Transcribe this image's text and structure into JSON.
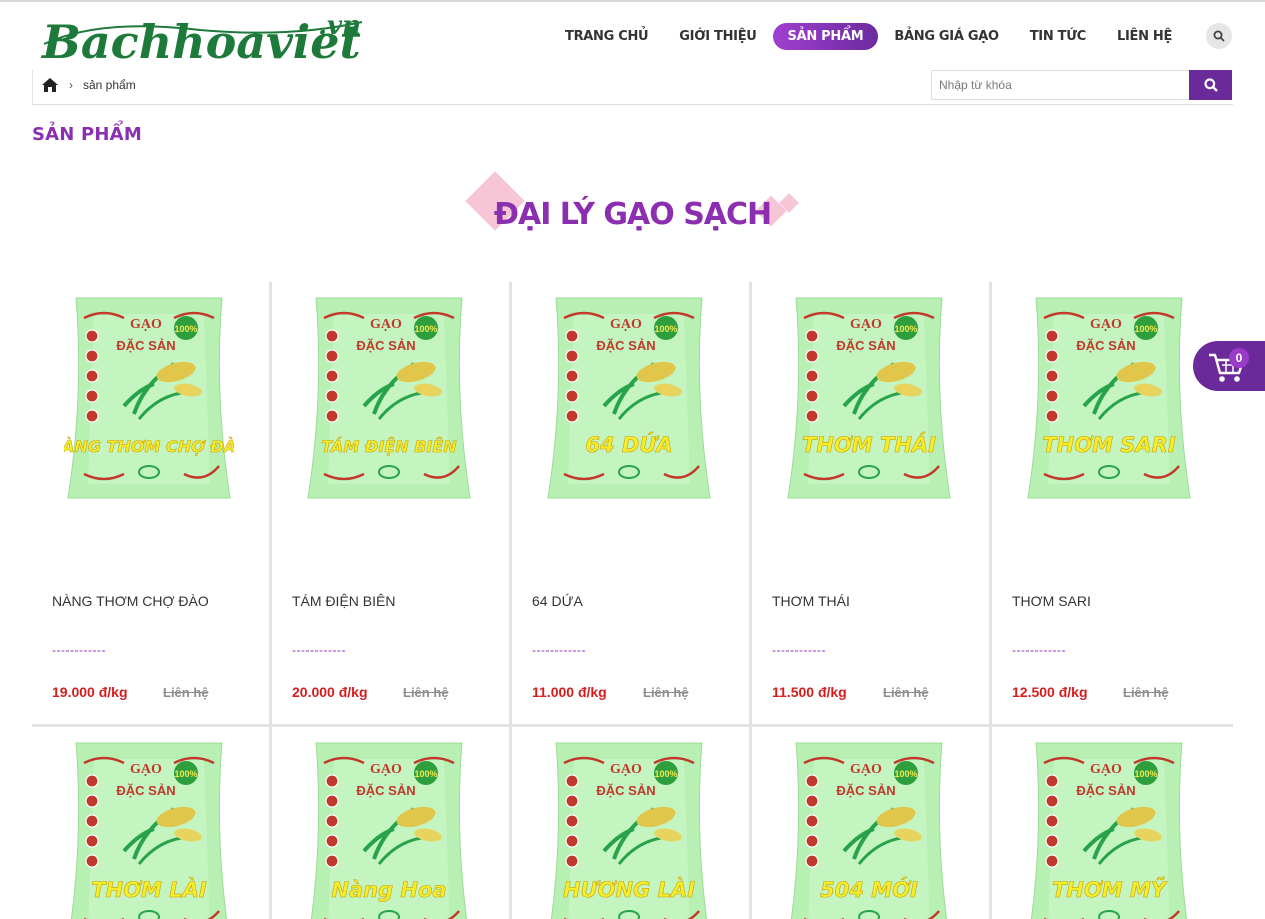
{
  "site": {
    "logo_text": "Bachhoaviet",
    "logo_suffix": ".vn"
  },
  "nav": {
    "items": [
      {
        "label": "TRANG CHỦ",
        "active": false
      },
      {
        "label": "GIỚI THIỆU",
        "active": false
      },
      {
        "label": "SẢN PHẨM",
        "active": true
      },
      {
        "label": "BẢNG GIÁ GẠO",
        "active": false
      },
      {
        "label": "TIN TỨC",
        "active": false
      },
      {
        "label": "LIÊN HỆ",
        "active": false
      }
    ]
  },
  "breadcrumb": {
    "home_icon": "home-icon",
    "current": "sản phẩm"
  },
  "search": {
    "placeholder": "Nhập từ khóa",
    "value": ""
  },
  "page": {
    "title": "SẢN PHẨM",
    "section_title": "ĐẠI LÝ GẠO SẠCH"
  },
  "bag": {
    "top": "GẠO",
    "sub": "ĐẶC SẢN",
    "badge": "100%"
  },
  "products": [
    {
      "name": "NÀNG THƠM CHỢ ĐÀO",
      "bag_label": "NÀNG THƠM CHỢ ĐÀO",
      "dash": "------------",
      "price": "19.000 đ/kg",
      "contact": "Liên hệ"
    },
    {
      "name": "TÁM ĐIỆN BIÊN",
      "bag_label": "TÁM ĐIỆN BIÊN",
      "dash": "------------",
      "price": "20.000 đ/kg",
      "contact": "Liên hệ"
    },
    {
      "name": "64 DỨA",
      "bag_label": "64 DỨA",
      "dash": "------------",
      "price": "11.000 đ/kg",
      "contact": "Liên hệ"
    },
    {
      "name": "THƠM THÁI",
      "bag_label": "THƠM THÁI",
      "dash": "------------",
      "price": "11.500 đ/kg",
      "contact": "Liên hệ"
    },
    {
      "name": "THƠM SARI",
      "bag_label": "THƠM SARI",
      "dash": "------------",
      "price": "12.500 đ/kg",
      "contact": "Liên hệ"
    }
  ],
  "products_row2": [
    {
      "bag_label": "THƠM LÀI"
    },
    {
      "bag_label": "Nàng Hoa"
    },
    {
      "bag_label": "HƯƠNG LÀI"
    },
    {
      "bag_label": "504 MỚI"
    },
    {
      "bag_label": "THƠM MỸ"
    }
  ],
  "cart": {
    "count": "0",
    "icon": "cart-icon"
  },
  "colors": {
    "brand_purple": "#8b2fb0",
    "button_purple": "#6b2a9a",
    "price_red": "#d41e1e",
    "logo_green": "#1e7a3a"
  }
}
